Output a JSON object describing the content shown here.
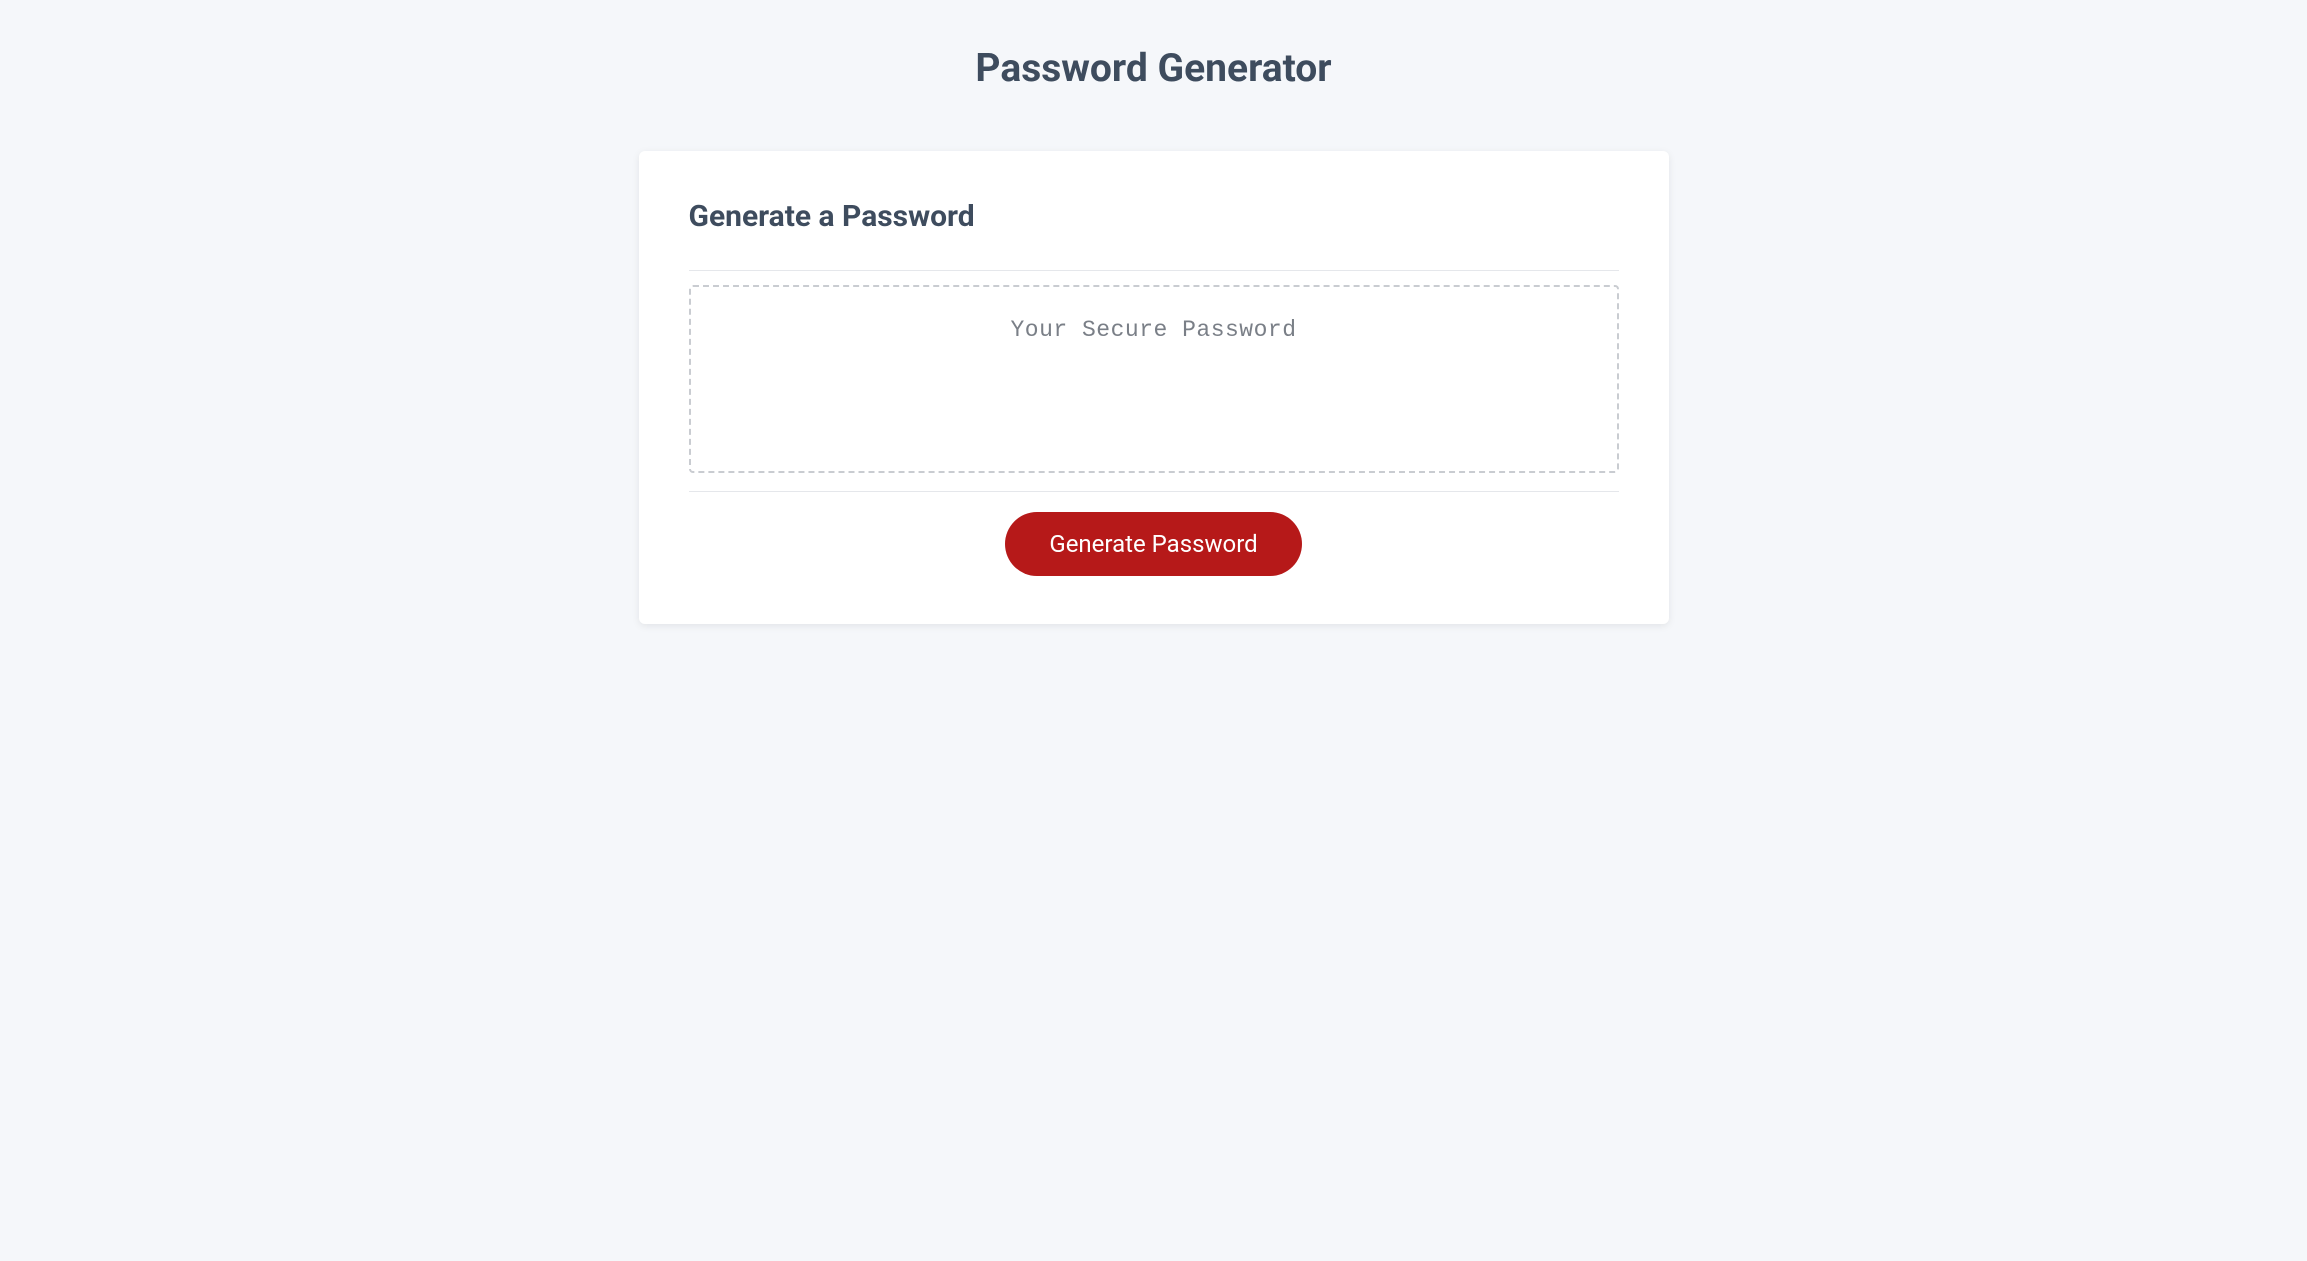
{
  "page": {
    "title": "Password Generator"
  },
  "card": {
    "heading": "Generate a Password",
    "output_placeholder": "Your Secure Password",
    "generate_button_label": "Generate Password"
  },
  "colors": {
    "accent": "#b61919",
    "background": "#f5f7fa",
    "card_bg": "#ffffff",
    "heading_text": "#3e4c5e",
    "placeholder_text": "#7a7f87",
    "dashed_border": "#c9ccd1"
  }
}
